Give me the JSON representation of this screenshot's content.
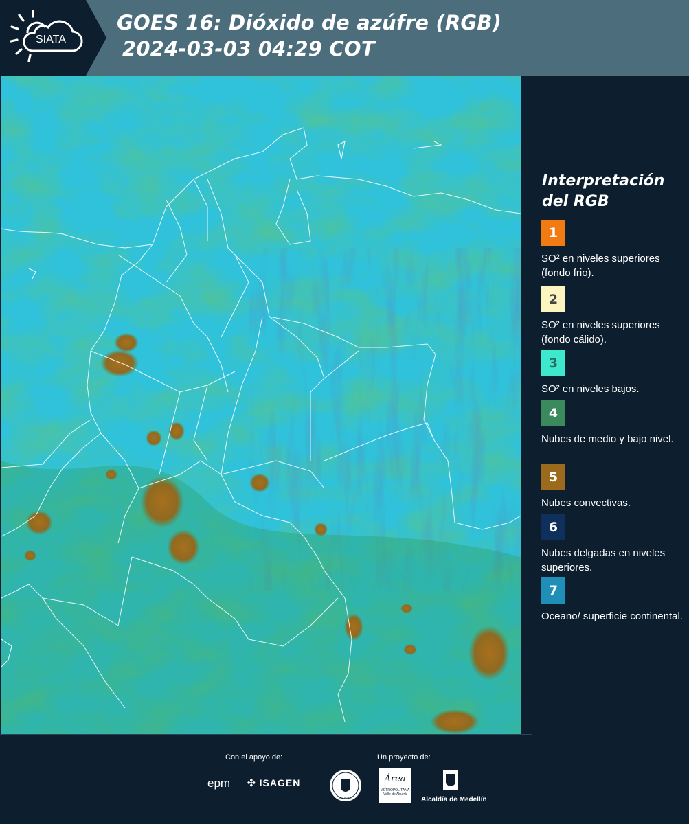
{
  "header": {
    "logo_text": "SIATA",
    "title_line1": "GOES 16: Dióxido de azúfre (RGB)",
    "title_line2": "2024-03-03 04:29 COT"
  },
  "legend": {
    "title": "Interpretación del RGB",
    "items": [
      {
        "number": "1",
        "color": "#f27a12",
        "text_color": "#ffffff",
        "label": "SO² en niveles superiores (fondo frio)."
      },
      {
        "number": "2",
        "color": "#fdf5c0",
        "text_color": "#444444",
        "label": "SO² en niveles superiores (fondo cálido)."
      },
      {
        "number": "3",
        "color": "#3ee8cc",
        "text_color": "#2a6f66",
        "label": "SO² en niveles bajos."
      },
      {
        "number": "4",
        "color": "#3a8a5e",
        "text_color": "#ffffff",
        "label": "Nubes de medio y bajo nivel."
      },
      {
        "number": "5",
        "color": "#9c6a1c",
        "text_color": "#ffffff",
        "label": "Nubes convectivas."
      },
      {
        "number": "6",
        "color": "#0f2f5c",
        "text_color": "#ffffff",
        "label": "Nubes delgadas en niveles superiores."
      },
      {
        "number": "7",
        "color": "#1f8fb8",
        "text_color": "#ffffff",
        "label": "Oceano/ superficie continental."
      }
    ]
  },
  "footer": {
    "support_label": "Con el apoyo de:",
    "project_label": "Un proyecto de:",
    "sponsor1": "epm",
    "sponsor2": "ISAGEN",
    "partner1": "MEDELLÍN",
    "partner2_name": "Área",
    "partner2_sub": "METROPOLITANA",
    "partner2_sub2": "Valle de Aburrá",
    "partner3": "Alcaldía de Medellín"
  },
  "colors": {
    "header_bg": "#4b6d7c",
    "panel_bg": "#0d1f2e",
    "map_base": "#2ec0d8",
    "map_green": "#2d9a55",
    "map_convective": "#9c6a1c"
  }
}
